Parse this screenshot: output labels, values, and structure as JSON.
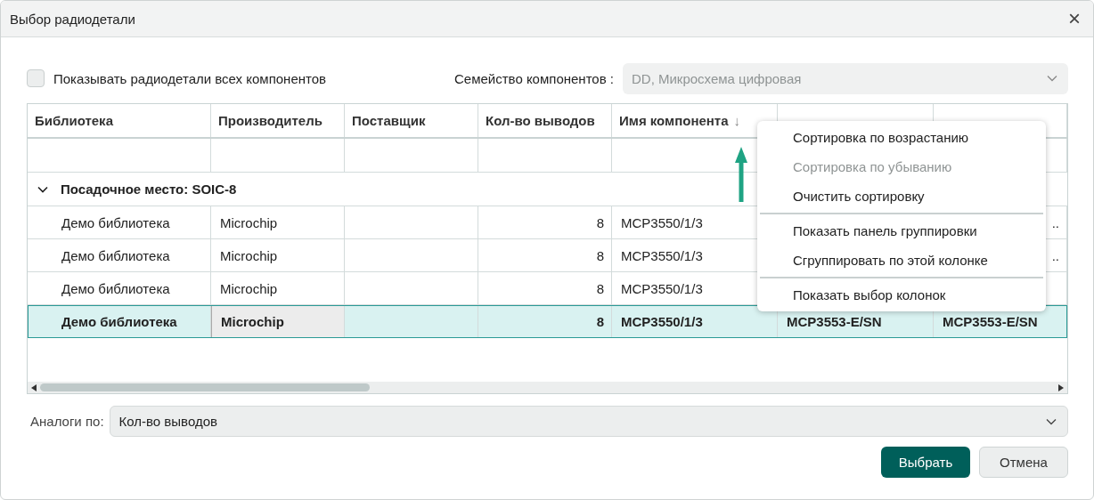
{
  "window": {
    "title": "Выбор радиодетали",
    "close": "×"
  },
  "show_all": {
    "label": "Показывать радиодетали всех компонентов",
    "checked": false
  },
  "family": {
    "label": "Семейство компонентов :",
    "value": "DD, Микросхема цифровая",
    "disabled": true
  },
  "table": {
    "columns": [
      {
        "label": "Библиотека"
      },
      {
        "label": "Производитель"
      },
      {
        "label": "Поставщик"
      },
      {
        "label": "Кол-во выводов"
      },
      {
        "label": "Имя компонента",
        "sort": "↓"
      },
      {},
      {}
    ],
    "group": {
      "label": "Посадочное место: SOIC-8",
      "expanded": true
    },
    "rows": [
      {
        "selected": false,
        "cells": [
          {
            "text": "Демо библиотека"
          },
          {
            "text": "Microchip"
          },
          {},
          {
            "text": "8",
            "right": true
          },
          {
            "text": "MCP3550/1/3"
          },
          {},
          {
            "text": "..",
            "right": true
          }
        ]
      },
      {
        "selected": false,
        "cells": [
          {
            "text": "Демо библиотека"
          },
          {
            "text": "Microchip"
          },
          {},
          {
            "text": "8",
            "right": true
          },
          {
            "text": "MCP3550/1/3"
          },
          {},
          {
            "text": "..",
            "right": true
          }
        ]
      },
      {
        "selected": false,
        "cells": [
          {
            "text": "Демо библиотека"
          },
          {
            "text": "Microchip"
          },
          {},
          {
            "text": "8",
            "right": true
          },
          {
            "text": "MCP3550/1/3"
          },
          {},
          {}
        ]
      },
      {
        "selected": true,
        "cells": [
          {
            "text": "Демо библиотека",
            "focused": false
          },
          {
            "text": "Microchip",
            "focused": true
          },
          {
            "focused": false
          },
          {
            "text": "8",
            "right": true,
            "focused": false
          },
          {
            "text": "MCP3550/1/3",
            "focused": false
          },
          {
            "text": "MCP3553-E/SN",
            "focused": false
          },
          {
            "text": "MCP3553-E/SN",
            "focused": false
          }
        ]
      }
    ]
  },
  "context_menu": {
    "groups": [
      [
        {
          "label": "Сортировка по возрастанию",
          "disabled": false
        },
        {
          "label": "Сортировка по убыванию",
          "disabled": true
        },
        {
          "label": "Очистить сортировку",
          "disabled": false
        }
      ],
      [
        {
          "label": "Показать панель группировки",
          "disabled": false
        },
        {
          "label": "Сгруппировать по этой колонке",
          "disabled": false
        }
      ],
      [
        {
          "label": "Показать выбор колонок",
          "disabled": false
        }
      ]
    ]
  },
  "analogs": {
    "label": "Аналоги по:",
    "value": "Кол-во выводов"
  },
  "buttons": [
    {
      "label": "Выбрать",
      "kind": "primary"
    },
    {
      "label": "Отмена",
      "kind": "secondary"
    }
  ]
}
